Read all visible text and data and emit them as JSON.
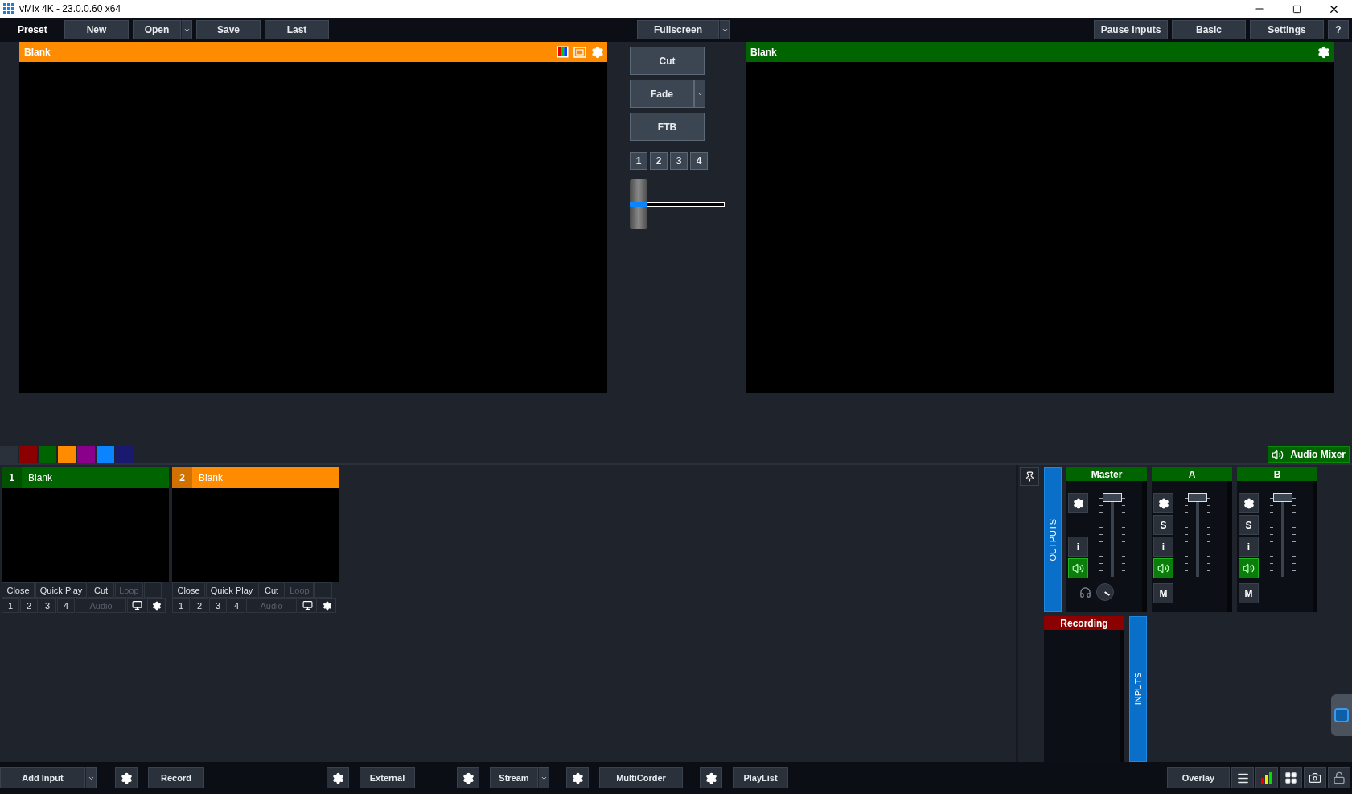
{
  "window": {
    "title": "vMix 4K - 23.0.0.60 x64"
  },
  "toolbar": {
    "label": "Preset",
    "left_buttons": [
      {
        "label": "New",
        "dropdown": false
      },
      {
        "label": "Open",
        "dropdown": true
      },
      {
        "label": "Save",
        "dropdown": false
      },
      {
        "label": "Last",
        "dropdown": false
      }
    ],
    "center_button": {
      "label": "Fullscreen",
      "dropdown": true
    },
    "right_buttons": [
      "Pause Inputs",
      "Basic",
      "Settings",
      "?"
    ]
  },
  "preview": {
    "title": "Blank"
  },
  "program": {
    "title": "Blank"
  },
  "transitions": {
    "buttons": [
      {
        "label": "Cut",
        "dropdown": false
      },
      {
        "label": "Fade",
        "dropdown": true
      },
      {
        "label": "FTB",
        "dropdown": false
      }
    ],
    "quick_buttons": [
      "1",
      "2",
      "3",
      "4"
    ],
    "tbar": {
      "level": 0
    }
  },
  "color_tabs": [
    {
      "color": "#2a313b"
    },
    {
      "color": "#8b0000"
    },
    {
      "color": "#006400"
    },
    {
      "color": "#ff8c00"
    },
    {
      "color": "#8b008b"
    },
    {
      "color": "#0a84ff"
    },
    {
      "color": "#191970"
    }
  ],
  "inputs": [
    {
      "number": "1",
      "title": "Blank",
      "color": "#006400",
      "actions": [
        {
          "label": "Close",
          "disabled": false
        },
        {
          "label": "Quick Play",
          "disabled": false
        },
        {
          "label": "Cut",
          "disabled": false
        },
        {
          "label": "Loop",
          "disabled": true
        }
      ],
      "overlays": [
        "1",
        "2",
        "3",
        "4"
      ],
      "audio": {
        "label": "Audio",
        "disabled": true
      }
    },
    {
      "number": "2",
      "title": "Blank",
      "color": "#ff8c00",
      "actions": [
        {
          "label": "Close",
          "disabled": false
        },
        {
          "label": "Quick Play",
          "disabled": false
        },
        {
          "label": "Cut",
          "disabled": false
        },
        {
          "label": "Loop",
          "disabled": true
        }
      ],
      "overlays": [
        "1",
        "2",
        "3",
        "4"
      ],
      "audio": {
        "label": "Audio",
        "disabled": true
      }
    }
  ],
  "audio_mixer": {
    "tab": "Audio Mixer",
    "outputs_label": "OUTPUTS",
    "inputs_label": "INPUTS",
    "buses": [
      {
        "kind": "master",
        "name": "Master",
        "info_label": "i",
        "level": 1,
        "audio_on": true
      },
      {
        "kind": "bus",
        "name": "A",
        "solo_label": "S",
        "info_label": "i",
        "mute_label": "M",
        "level": 1,
        "audio_on": true
      },
      {
        "kind": "bus",
        "name": "B",
        "solo_label": "S",
        "info_label": "i",
        "mute_label": "M",
        "level": 1,
        "audio_on": true
      }
    ],
    "recording": {
      "title": "Recording"
    }
  },
  "bottom_bar": {
    "groups": [
      {
        "label": "Add Input",
        "settings": false,
        "dropdown": true
      },
      {
        "label": "Record",
        "settings": true,
        "dropdown": false
      },
      {
        "label": "External",
        "settings": true,
        "dropdown": false
      },
      {
        "label": "Stream",
        "settings": true,
        "dropdown": true
      },
      {
        "label": "MultiCorder",
        "settings": true,
        "dropdown": false
      },
      {
        "label": "PlayList",
        "settings": true,
        "dropdown": false
      }
    ],
    "overlay": "Overlay"
  }
}
